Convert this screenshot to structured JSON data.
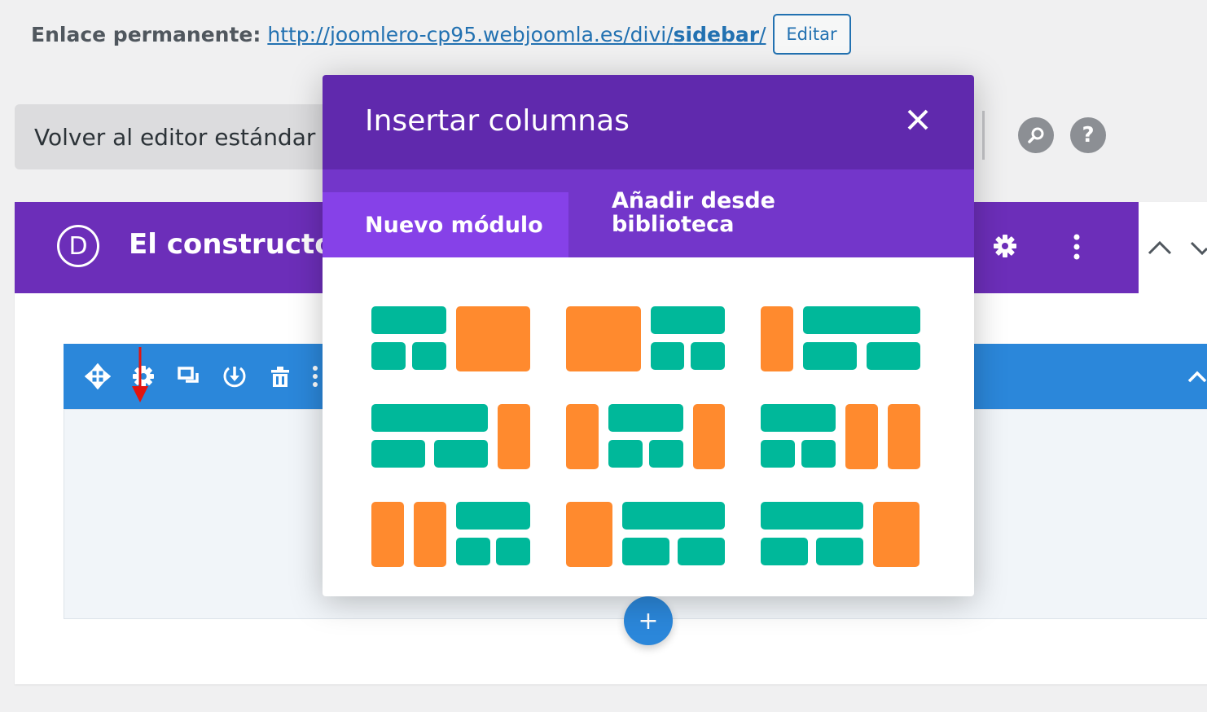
{
  "permalink": {
    "label": "Enlace permanente:",
    "url_prefix": "http://joomlero-cp95.webjoomla.es/divi/",
    "url_slug": "sidebar",
    "url_suffix": "/",
    "edit_label": "Editar"
  },
  "toolbar": {
    "back_label": "Volver al editor estándar",
    "search_icon": "search-icon",
    "help_label": "?"
  },
  "builder": {
    "logo_letter": "D",
    "title": "El constructor",
    "icons": [
      "gear-icon",
      "more-vertical-icon",
      "chevron-up-icon",
      "chevron-down-icon"
    ]
  },
  "row_tools": [
    "move-icon",
    "gear-icon",
    "duplicate-icon",
    "save-icon",
    "trash-icon",
    "more-vertical-icon"
  ],
  "add_button": {
    "label": "+"
  },
  "modal": {
    "title": "Insertar columnas",
    "tabs": [
      {
        "label": "Nuevo módulo",
        "active": true
      },
      {
        "label": "Añadir desde biblioteca",
        "active": false
      }
    ]
  },
  "colors": {
    "purple_dark": "#6029ad",
    "purple": "#6c2eb9",
    "tab_active": "#8641e8",
    "teal": "#00b89a",
    "orange": "#ff8a2e",
    "blue": "#2b87da",
    "link": "#2271b1"
  }
}
